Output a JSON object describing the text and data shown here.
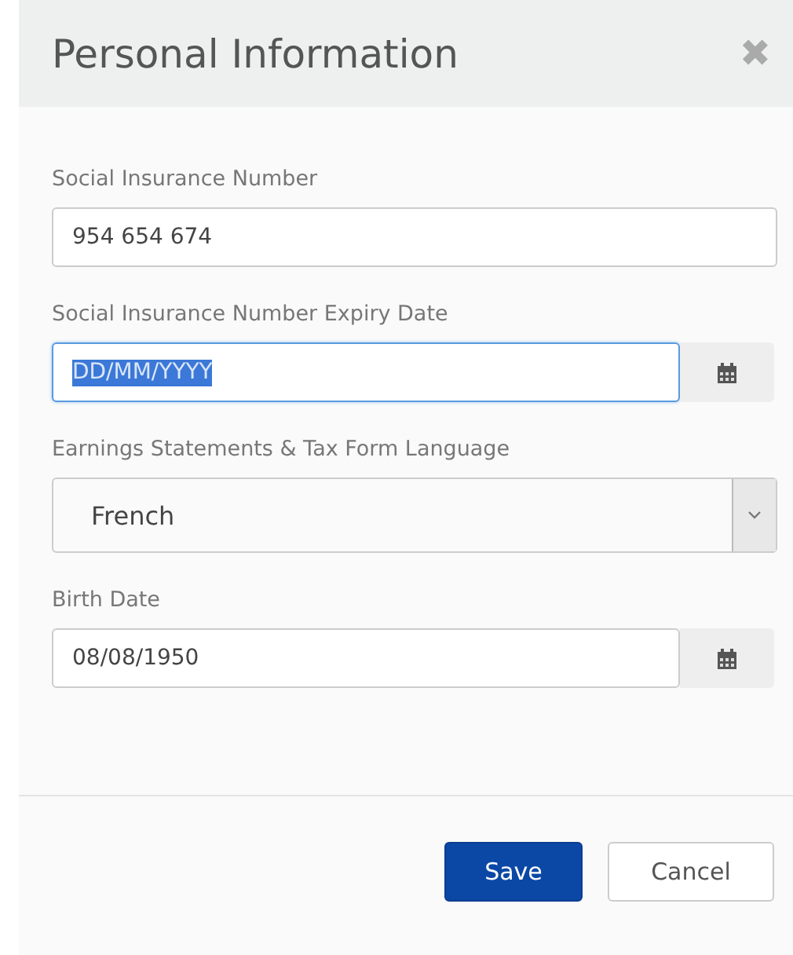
{
  "dialog": {
    "title": "Personal Information",
    "close_icon": "✖"
  },
  "fields": [
    {
      "kind": "text",
      "label": "Social Insurance Number",
      "value": "954 654 674"
    },
    {
      "kind": "date",
      "label": "Social Insurance Number Expiry Date",
      "value": "DD/MM/YYYY",
      "focused": true
    },
    {
      "kind": "select",
      "label": "Earnings Statements & Tax Form Language",
      "value": "French"
    },
    {
      "kind": "date",
      "label": "Birth Date",
      "value": "08/08/1950"
    }
  ],
  "buttons": [
    {
      "label": "Save",
      "primary": true
    },
    {
      "label": "Cancel",
      "primary": false
    }
  ]
}
